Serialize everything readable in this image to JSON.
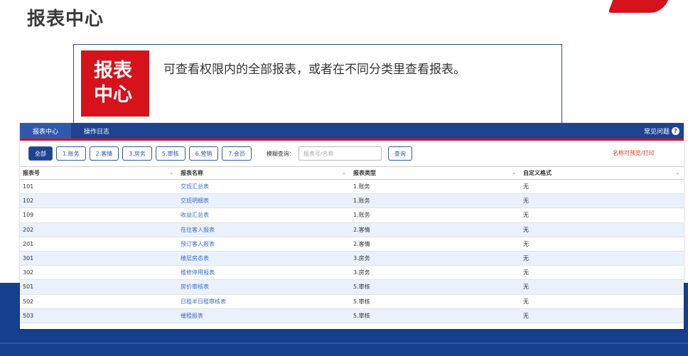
{
  "page": {
    "title": "报表中心"
  },
  "intro": {
    "badge_line1": "报表",
    "badge_line2": "中心",
    "text": "可查看权限内的全部报表，或者在不同分类里查看报表。"
  },
  "app": {
    "tabs": [
      {
        "label": "报表中心",
        "active": true
      },
      {
        "label": "操作日志",
        "active": false
      }
    ],
    "faq_label": "常见问题",
    "filters": [
      "全部",
      "1.账务",
      "2.客情",
      "3.房务",
      "5.审核",
      "6.营销",
      "7.会员"
    ],
    "fuzzy_label": "模糊查询：",
    "search_placeholder": "报表号/名称",
    "query_label": "查询",
    "hint": "名称可预览/打印",
    "columns": [
      "报表号",
      "报表名称",
      "报表类型",
      "自定义格式"
    ],
    "rows": [
      {
        "id": "101",
        "name": "交班汇总表",
        "type": "1.账务",
        "format": "无"
      },
      {
        "id": "102",
        "name": "交班明细表",
        "type": "1.账务",
        "format": "无"
      },
      {
        "id": "109",
        "name": "收益汇总表",
        "type": "1.账务",
        "format": "无"
      },
      {
        "id": "202",
        "name": "在住客人报表",
        "type": "2.客情",
        "format": "无"
      },
      {
        "id": "201",
        "name": "预订客人报表",
        "type": "2.客情",
        "format": "无"
      },
      {
        "id": "301",
        "name": "楼层房态表",
        "type": "3.房务",
        "format": "无"
      },
      {
        "id": "302",
        "name": "维修停用报表",
        "type": "3.房务",
        "format": "无"
      },
      {
        "id": "501",
        "name": "房价审核表",
        "type": "5.审核",
        "format": "无"
      },
      {
        "id": "502",
        "name": "日租半日租审核表",
        "type": "5.审核",
        "format": "无"
      },
      {
        "id": "503",
        "name": "催租报表",
        "type": "5.审核",
        "format": "无"
      }
    ]
  },
  "colors": {
    "brand_red": "#d6121b",
    "nav_blue": "#1e4490",
    "link_blue": "#3a6cc4",
    "hint_red": "#e8332a"
  }
}
